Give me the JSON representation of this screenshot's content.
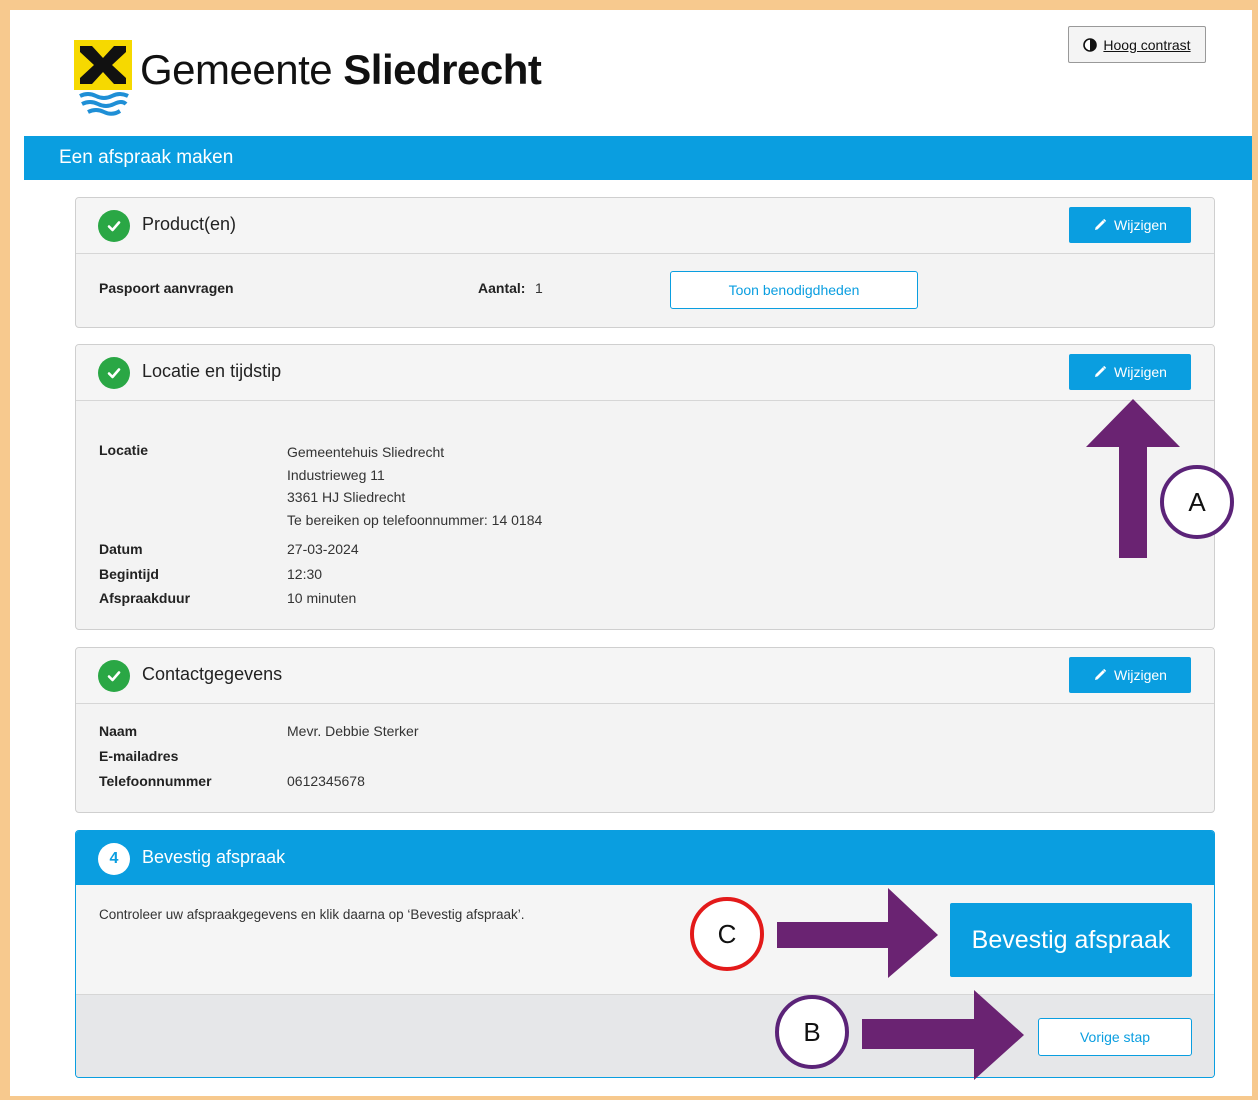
{
  "header": {
    "brand_regular": "Gemeente ",
    "brand_bold": "Sliedrecht",
    "contrast_label": "Hoog contrast"
  },
  "topbar": {
    "title": "Een afspraak maken"
  },
  "products": {
    "title": "Product(en)",
    "edit_label": "Wijzigen",
    "product_name": "Paspoort aanvragen",
    "count_label": "Aantal:",
    "count_value": "1",
    "show_button": "Toon benodigdheden"
  },
  "location": {
    "title": "Locatie en tijdstip",
    "edit_label": "Wijzigen",
    "location_label": "Locatie",
    "address_lines": [
      "Gemeentehuis Sliedrecht",
      "Industrieweg 11",
      "3361 HJ Sliedrecht",
      "Te bereiken op telefoonnummer: 14 0184"
    ],
    "date_label": "Datum",
    "date_value": "27-03-2024",
    "start_label": "Begintijd",
    "start_value": "12:30",
    "duration_label": "Afspraakduur",
    "duration_value": "10 minuten"
  },
  "contact": {
    "title": "Contactgegevens",
    "edit_label": "Wijzigen",
    "name_label": "Naam",
    "name_value": "Mevr. Debbie Sterker",
    "email_label": "E-mailadres",
    "email_value": "",
    "phone_label": "Telefoonnummer",
    "phone_value": "0612345678"
  },
  "confirm": {
    "step_number": "4",
    "title": "Bevestig afspraak",
    "instruction": "Controleer uw afspraakgegevens en klik daarna op ‘Bevestig afspraak’.",
    "confirm_button": "Bevestig afspraak",
    "back_button": "Vorige stap"
  },
  "annotations": {
    "label_a": "A",
    "label_b": "B",
    "label_c": "C",
    "arrow_color": "#6a2372",
    "circle_ab_color": "#5b2378",
    "circle_c_color": "#e31a1a"
  },
  "colors": {
    "accent": "#0a9ee0",
    "success": "#2aa745",
    "page_border": "#f7c98e"
  }
}
